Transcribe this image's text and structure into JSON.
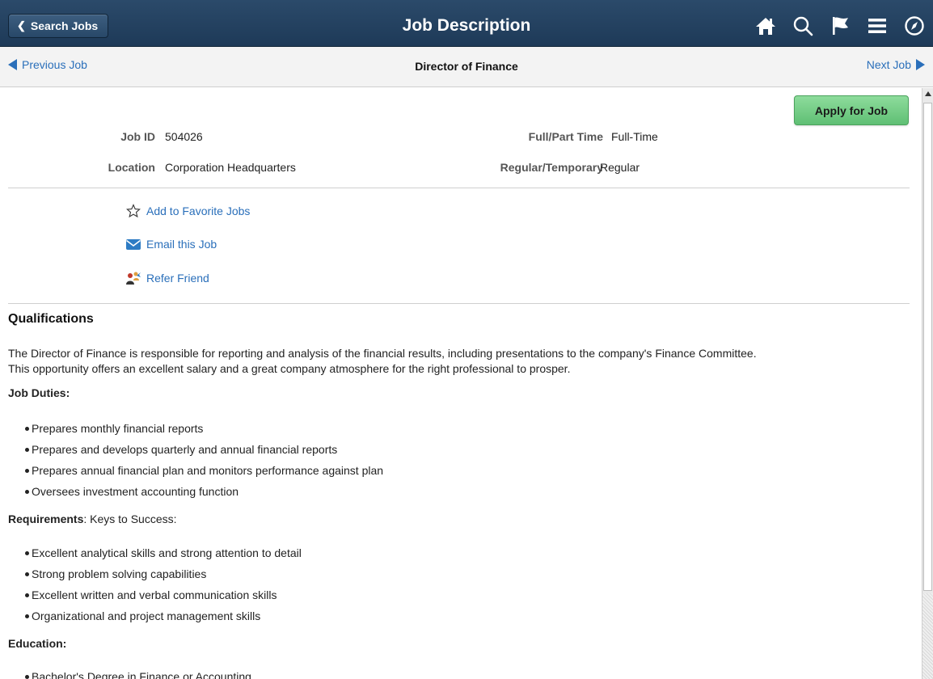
{
  "banner": {
    "back_label": "Search Jobs",
    "title": "Job Description",
    "icons": [
      "home-icon",
      "search-icon",
      "flag-icon",
      "menu-icon",
      "compass-icon"
    ],
    "bg_color": "#22405f"
  },
  "subnav": {
    "prev_label": "Previous Job",
    "title": "Director of Finance",
    "next_label": "Next Job",
    "link_color": "#2a6fba"
  },
  "apply_label": "Apply for Job",
  "fields": {
    "job_id_label": "Job ID",
    "job_id_value": "504026",
    "location_label": "Location",
    "location_value": "Corporation Headquarters",
    "full_part_label": "Full/Part Time",
    "full_part_value": "Full-Time",
    "reg_temp_label": "Regular/Temporary",
    "reg_temp_value": "Regular"
  },
  "actions": {
    "favorite_label": "Add to Favorite Jobs",
    "email_label": "Email this Job",
    "refer_label": "Refer Friend"
  },
  "qualifications": {
    "title": "Qualifications",
    "intro_line1": "The Director of Finance is responsible for reporting and analysis of the financial results, including presentations to the company's Finance Committee.",
    "intro_line2": "This opportunity offers an excellent salary and a great company atmosphere for the right professional to prosper.",
    "duties_heading": "Job Duties:",
    "duties": [
      "Prepares monthly financial reports",
      "Prepares and develops quarterly and annual financial reports",
      "Prepares annual financial plan and monitors performance against plan",
      "Oversees investment accounting function"
    ],
    "requirements_heading": "Requirements",
    "requirements_sub": ":  Keys to Success:",
    "requirements": [
      "Excellent analytical skills and strong attention to detail",
      "Strong problem solving capabilities",
      "Excellent written and verbal communication skills",
      "Organizational and project management skills"
    ],
    "education_heading": "Education:",
    "education": [
      "Bachelor's Degree in Finance or Accounting"
    ]
  },
  "apply_color": "#6cc77f"
}
